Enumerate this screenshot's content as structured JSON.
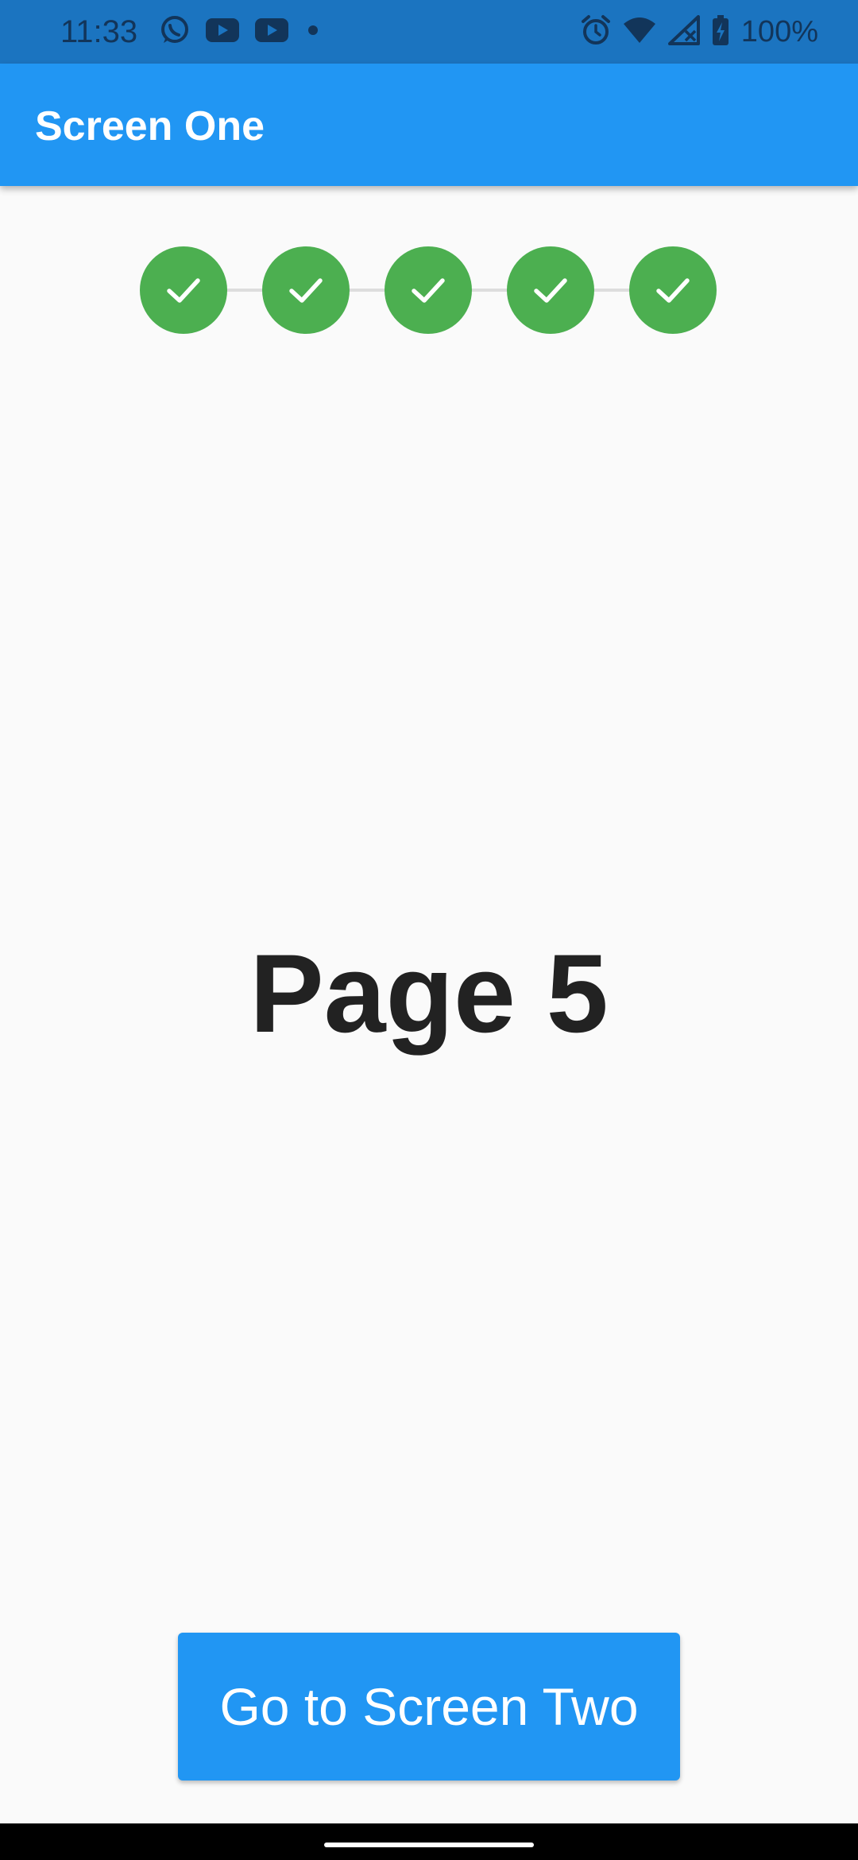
{
  "status_bar": {
    "time": "11:33",
    "left_icons": [
      "whatsapp-icon",
      "youtube-icon",
      "youtube-icon",
      "notification-dot-icon"
    ],
    "right_icons": [
      "alarm-icon",
      "wifi-icon",
      "cellular-no-signal-icon",
      "battery-charging-icon"
    ],
    "battery": "100%"
  },
  "app_bar": {
    "title": "Screen One",
    "color": "#2196f3"
  },
  "stepper": {
    "steps": [
      {
        "state": "complete",
        "icon": "check-icon"
      },
      {
        "state": "complete",
        "icon": "check-icon"
      },
      {
        "state": "complete",
        "icon": "check-icon"
      },
      {
        "state": "complete",
        "icon": "check-icon"
      },
      {
        "state": "complete",
        "icon": "check-icon"
      }
    ],
    "complete_color": "#4caf50"
  },
  "main": {
    "page_label": "Page 5"
  },
  "actions": {
    "go_button_label": "Go to Screen Two"
  }
}
